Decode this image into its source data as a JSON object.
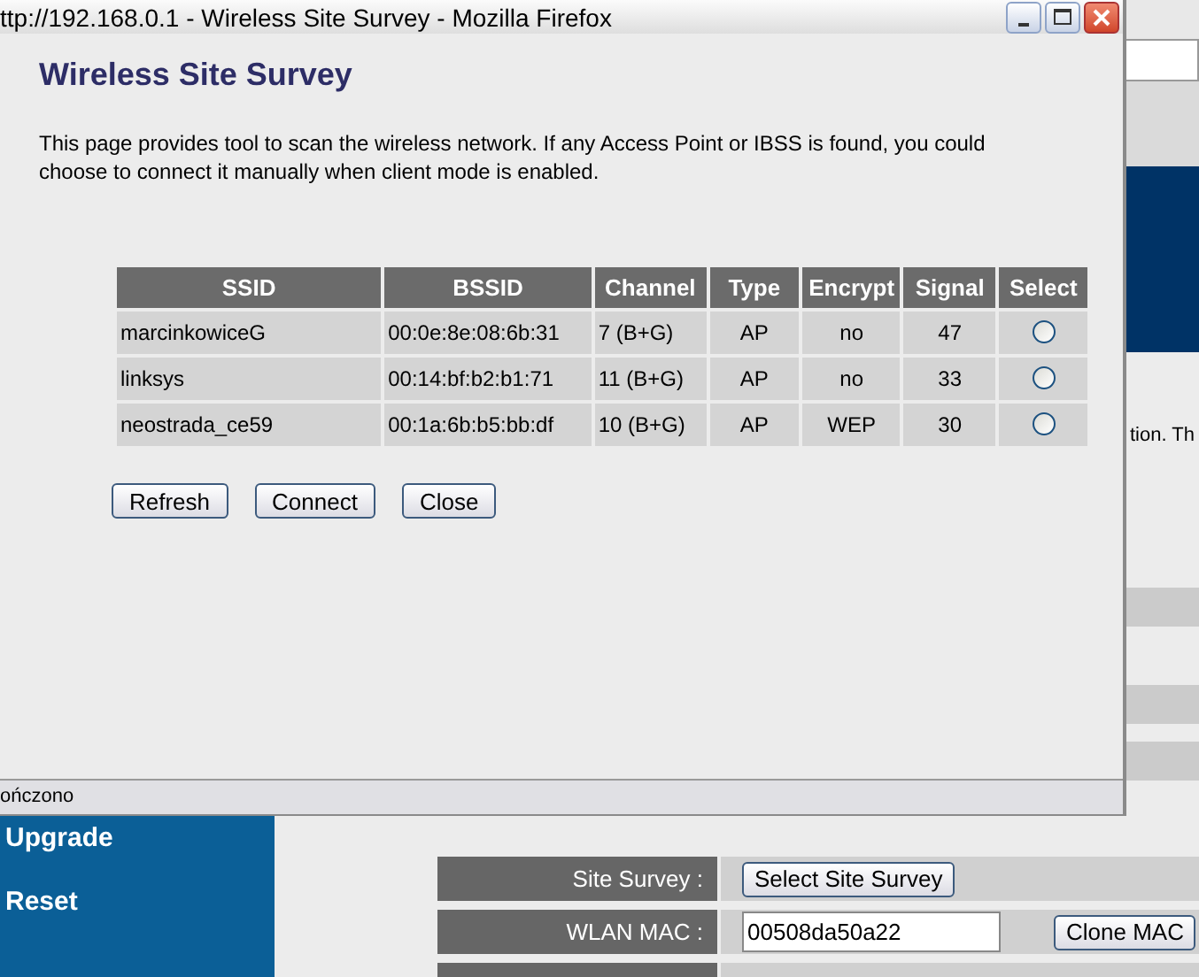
{
  "background_page": {
    "side_text": "tion. Th",
    "sidebar": {
      "items": [
        "Upgrade",
        "Reset"
      ]
    },
    "form": {
      "rows": [
        {
          "kind": "button",
          "label": "Site Survey :",
          "button": "Select Site Survey"
        },
        {
          "kind": "input",
          "label": "WLAN MAC :",
          "value": "00508da50a22",
          "button": "Clone MAC"
        }
      ]
    }
  },
  "popup": {
    "window": {
      "title": "ttp://192.168.0.1 - Wireless Site Survey - Mozilla Firefox"
    },
    "heading": "Wireless Site Survey",
    "description": "This page provides tool to scan the wireless network. If any Access Point or IBSS is found, you could choose to connect it manually when client mode is enabled.",
    "table": {
      "columns": [
        "SSID",
        "BSSID",
        "Channel",
        "Type",
        "Encrypt",
        "Signal",
        "Select"
      ],
      "rows": [
        {
          "ssid": "marcinkowiceG",
          "bssid": "00:0e:8e:08:6b:31",
          "channel": "7 (B+G)",
          "type": "AP",
          "encrypt": "no",
          "signal": "47",
          "selected": false
        },
        {
          "ssid": "linksys",
          "bssid": "00:14:bf:b2:b1:71",
          "channel": "11 (B+G)",
          "type": "AP",
          "encrypt": "no",
          "signal": "33",
          "selected": false
        },
        {
          "ssid": "neostrada_ce59",
          "bssid": "00:1a:6b:b5:bb:df",
          "channel": "10 (B+G)",
          "type": "AP",
          "encrypt": "WEP",
          "signal": "30",
          "selected": false
        }
      ]
    },
    "buttons": [
      "Refresh",
      "Connect",
      "Close"
    ],
    "status_bar": "ończono"
  }
}
